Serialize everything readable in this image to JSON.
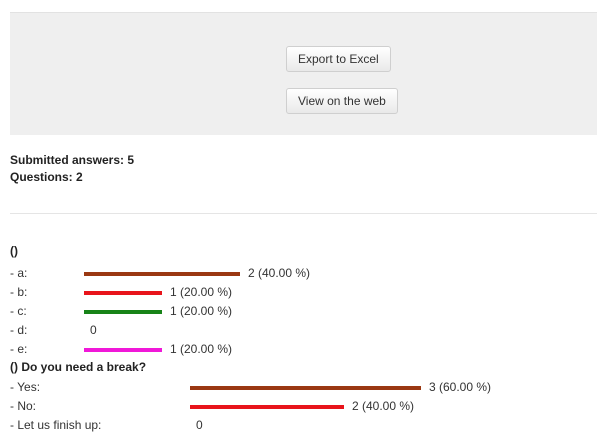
{
  "toolbar": {
    "export_label": "Export to Excel",
    "view_web_label": "View on the web"
  },
  "summary": {
    "submitted": "Submitted answers: 5",
    "questions": "Questions: 2"
  },
  "chart_data": [
    {
      "type": "bar",
      "title": "()",
      "options": [
        {
          "label": "- a:",
          "count": 2,
          "percent": 40.0,
          "text": "2 (40.00 %)",
          "color": "#9a3812"
        },
        {
          "label": "- b:",
          "count": 1,
          "percent": 20.0,
          "text": "1 (20.00 %)",
          "color": "#e8141b"
        },
        {
          "label": "- c:",
          "count": 1,
          "percent": 20.0,
          "text": "1 (20.00 %)",
          "color": "#178318"
        },
        {
          "label": "- d:",
          "count": 0,
          "percent": 0.0,
          "text": "0",
          "color": "#999999"
        },
        {
          "label": "- e:",
          "count": 1,
          "percent": 20.0,
          "text": "1 (20.00 %)",
          "color": "#f018d8"
        }
      ]
    },
    {
      "type": "bar",
      "title": "() Do you need a break?",
      "options": [
        {
          "label": "- Yes:",
          "count": 3,
          "percent": 60.0,
          "text": "3 (60.00 %)",
          "color": "#9a3812"
        },
        {
          "label": "- No:",
          "count": 2,
          "percent": 40.0,
          "text": "2 (40.00 %)",
          "color": "#e8141b"
        },
        {
          "label": "- Let us finish up:",
          "count": 0,
          "percent": 0.0,
          "text": "0",
          "color": "#999999"
        }
      ]
    }
  ]
}
